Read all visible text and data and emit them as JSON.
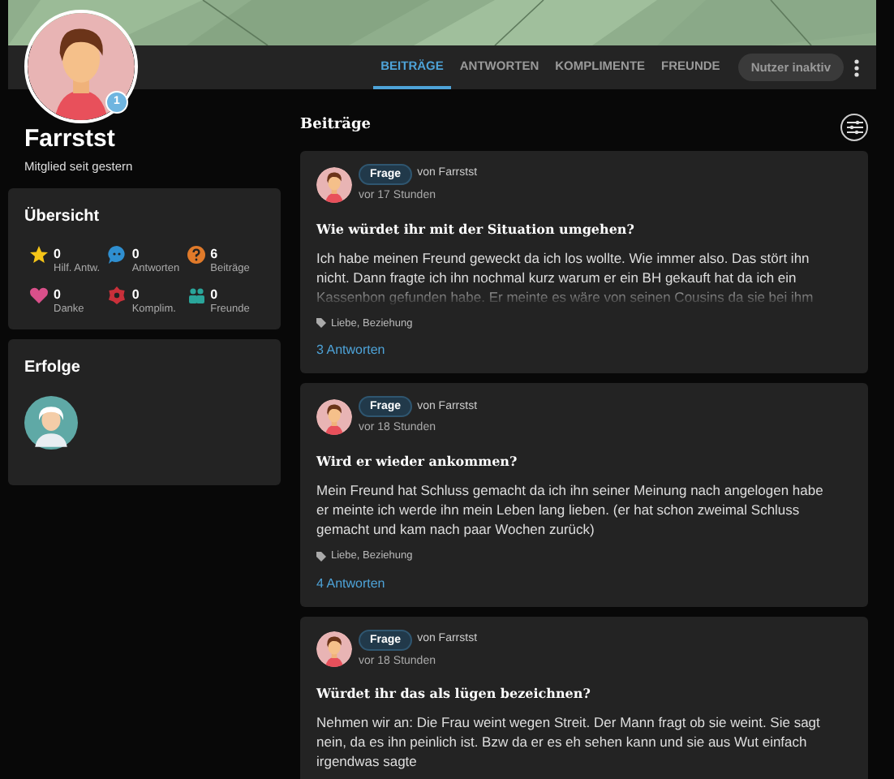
{
  "profile": {
    "name": "Farrstst",
    "subtitle": "Mitglied seit gestern",
    "badge": "1"
  },
  "tabs": [
    {
      "label": "BEITRÄGE",
      "selected": true
    },
    {
      "label": "ANTWORTEN",
      "selected": false
    },
    {
      "label": "KOMPLIMENTE",
      "selected": false
    },
    {
      "label": "FREUNDE",
      "selected": false
    }
  ],
  "status_button": "Nutzer inaktiv",
  "overview": {
    "title": "Übersicht",
    "stats": [
      {
        "kind": "star",
        "value": "0",
        "label": "Hilf. Antw.",
        "color": "#f5c518"
      },
      {
        "kind": "bubble",
        "value": "0",
        "label": "Antworten",
        "color": "#2f8fd0"
      },
      {
        "kind": "question",
        "value": "6",
        "label": "Beiträge",
        "color": "#e07a2a"
      },
      {
        "kind": "heart",
        "value": "0",
        "label": "Danke",
        "color": "#d9508a"
      },
      {
        "kind": "flower",
        "value": "0",
        "label": "Komplim.",
        "color": "#c9303a"
      },
      {
        "kind": "people",
        "value": "0",
        "label": "Freunde",
        "color": "#2aa59a"
      }
    ]
  },
  "achievements": {
    "title": "Erfolge"
  },
  "section_title": "Beiträge",
  "posts": [
    {
      "tag": "Frage",
      "author": "von Farrstst",
      "time": "vor 17 Stunden",
      "title": "Wie würdet ihr mit der Situation umgehen?",
      "body": "Ich habe meinen Freund geweckt da ich los wollte. Wie immer also. Das stört ihn nicht. Dann fragte ich ihn nochmal kurz warum er ein BH gekauft hat da ich ein Kassenbon gefunden habe. Er meinte es wäre von seinen Cousins da sie bei ihm",
      "collapsed": true,
      "topics": "Liebe, Beziehung",
      "answers": "3 Antworten"
    },
    {
      "tag": "Frage",
      "author": "von Farrstst",
      "time": "vor 18 Stunden",
      "title": "Wird er wieder ankommen?",
      "body": "Mein Freund hat Schluss gemacht da ich ihn seiner Meinung nach angelogen habe er meinte ich werde ihn mein Leben lang lieben. (er hat schon zweimal Schluss gemacht und kam nach paar Wochen zurück)",
      "collapsed": false,
      "topics": "Liebe, Beziehung",
      "answers": "4 Antworten"
    },
    {
      "tag": "Frage",
      "author": "von Farrstst",
      "time": "vor 18 Stunden",
      "title": "Würdet ihr das als lügen bezeichnen?",
      "body": "Nehmen wir an: Die Frau weint wegen Streit. Der Mann fragt ob sie weint. Sie sagt nein, da es ihn peinlich ist. Bzw da er es eh sehen kann und sie aus Wut einfach irgendwas sagte",
      "collapsed": false
    }
  ]
}
